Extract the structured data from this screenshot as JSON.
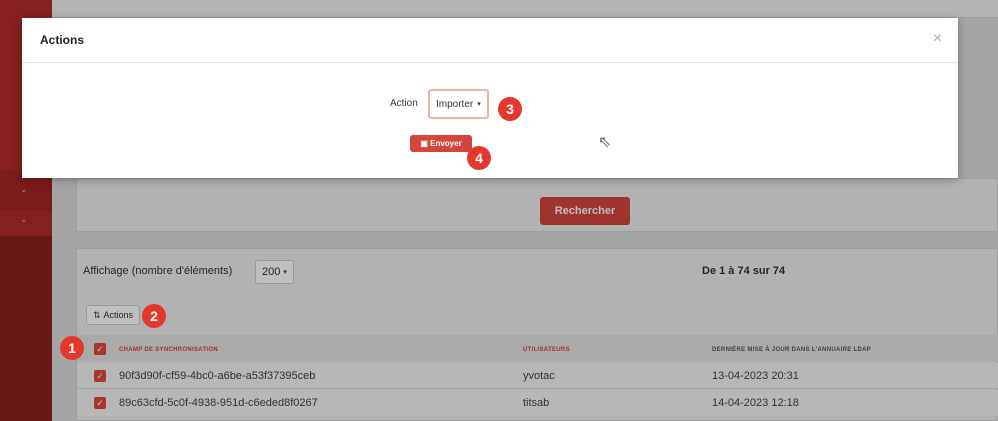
{
  "modal": {
    "title": "Actions",
    "close_glyph": "×",
    "action_label": "Action",
    "action_select_value": "Importer",
    "send_button_label": "Envoyer"
  },
  "search": {
    "button_label": "Rechercher"
  },
  "list": {
    "display_label": "Affichage (nombre d'éléments)",
    "display_value": "200",
    "range_text": "De 1 à 74 sur 74",
    "actions_button_label": "Actions",
    "columns": [
      "Champ de synchronisation",
      "Utilisateurs",
      "Dernière mise à jour dans l'annuaire LDAP"
    ],
    "rows": [
      {
        "sync_field": "90f3d90f-cf59-4bc0-a6be-a53f37395ceb",
        "user": "yvotac",
        "updated": "13-04-2023 20:31"
      },
      {
        "sync_field": "89c63cfd-5c0f-4938-951d-c6eded8f0267",
        "user": "titsab",
        "updated": "14-04-2023 12:18"
      }
    ]
  },
  "markers": [
    "1",
    "2",
    "3",
    "4"
  ],
  "colors": {
    "accent": "#d4453d",
    "sidebar": "#b32a2a",
    "marker": "#e5382d"
  },
  "icons": {
    "close": "close-icon",
    "send": "save-icon",
    "actions": "sort-icon",
    "dropdown": "chevron-down-icon",
    "check": "checkmark-icon"
  }
}
